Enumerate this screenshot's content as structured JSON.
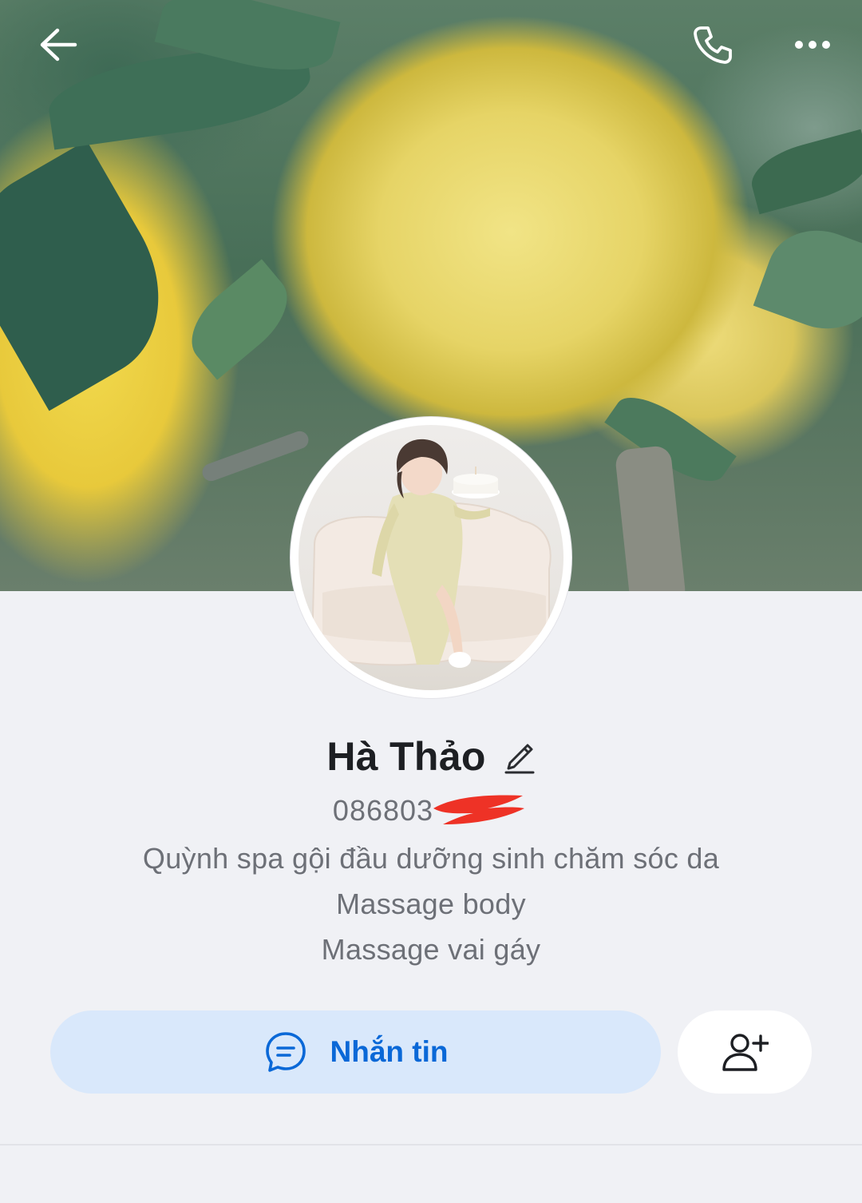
{
  "header": {
    "back_icon": "arrow-left-icon",
    "call_icon": "phone-icon",
    "more_icon": "more-horizontal-icon"
  },
  "profile": {
    "name": "Hà Thảo",
    "phone": "086803",
    "phone_redacted": true,
    "bio": [
      "Quỳnh spa gội đầu dưỡng sinh chăm sóc da",
      "Massage body",
      "Massage vai gáy"
    ]
  },
  "actions": {
    "message_label": "Nhắn tin",
    "message_icon": "chat-bubble-icon",
    "add_friend_icon": "add-user-icon"
  },
  "colors": {
    "accent": "#0a68d7",
    "message_button_bg": "#d9e8fb",
    "page_bg": "#f0f1f5"
  }
}
